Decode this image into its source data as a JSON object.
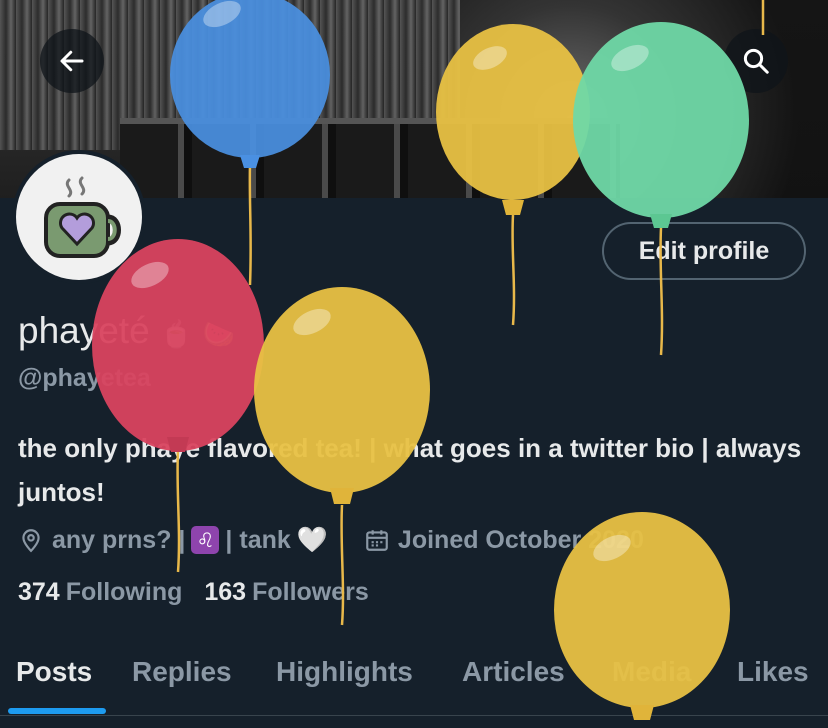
{
  "header": {
    "back_label": "back",
    "search_label": "search"
  },
  "profile": {
    "display_name": "phayeté",
    "handle": "@phayetea",
    "edit_label": "Edit profile",
    "bio": "the only phaye flavored tea! | what goes in a twitter bio | always juntos!",
    "location_text": "any prns? |",
    "location_tail": "| tank",
    "joined_text": "Joined October 2020"
  },
  "stats": {
    "following_count": "374",
    "following_label": "Following",
    "followers_count": "163",
    "followers_label": "Followers"
  },
  "tabs": [
    "Posts",
    "Replies",
    "Highlights",
    "Articles",
    "Media",
    "Likes"
  ],
  "colors": {
    "accent": "#1d9bf0",
    "background": "#15202b",
    "muted": "#8b98a5"
  }
}
